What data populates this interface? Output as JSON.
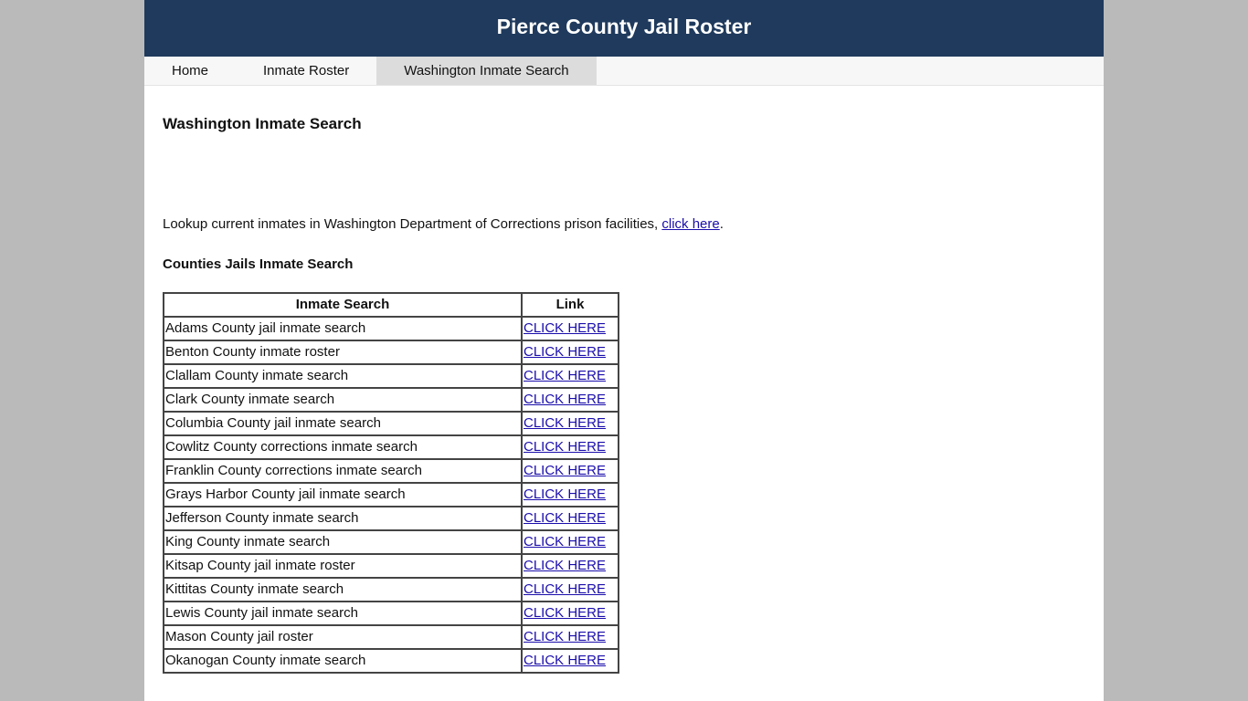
{
  "header": {
    "title": "Pierce County Jail Roster"
  },
  "nav": {
    "items": [
      {
        "label": "Home",
        "active": false
      },
      {
        "label": "Inmate Roster",
        "active": false
      },
      {
        "label": "Washington Inmate Search",
        "active": true
      }
    ]
  },
  "main": {
    "page_title": "Washington Inmate Search",
    "intro_text": "Lookup current inmates in Washington Department of Corrections prison facilities, ",
    "intro_link": "click here",
    "intro_suffix": ".",
    "section_title": "Counties Jails Inmate Search",
    "table": {
      "headers": [
        "Inmate Search",
        "Link"
      ],
      "rows": [
        {
          "name": "Adams County jail inmate search",
          "link": "CLICK HERE"
        },
        {
          "name": "Benton County inmate roster",
          "link": "CLICK HERE"
        },
        {
          "name": "Clallam County inmate search",
          "link": "CLICK HERE"
        },
        {
          "name": "Clark County inmate search",
          "link": "CLICK HERE"
        },
        {
          "name": "Columbia County jail inmate search",
          "link": "CLICK HERE"
        },
        {
          "name": "Cowlitz County corrections inmate search",
          "link": "CLICK HERE"
        },
        {
          "name": "Franklin County corrections inmate search",
          "link": "CLICK HERE"
        },
        {
          "name": "Grays Harbor County jail inmate search",
          "link": "CLICK HERE"
        },
        {
          "name": "Jefferson County inmate search",
          "link": "CLICK HERE"
        },
        {
          "name": "King County inmate search",
          "link": "CLICK HERE"
        },
        {
          "name": "Kitsap County jail inmate roster",
          "link": "CLICK HERE"
        },
        {
          "name": "Kittitas County inmate search",
          "link": "CLICK HERE"
        },
        {
          "name": "Lewis County jail inmate search",
          "link": "CLICK HERE"
        },
        {
          "name": "Mason County jail roster",
          "link": "CLICK HERE"
        },
        {
          "name": "Okanogan County inmate search",
          "link": "CLICK HERE"
        }
      ]
    }
  },
  "colors": {
    "header_bg": "#1f3a5d",
    "page_bg": "#bababa",
    "nav_active_bg": "#dcdcdc",
    "link": "#1a0dab"
  }
}
